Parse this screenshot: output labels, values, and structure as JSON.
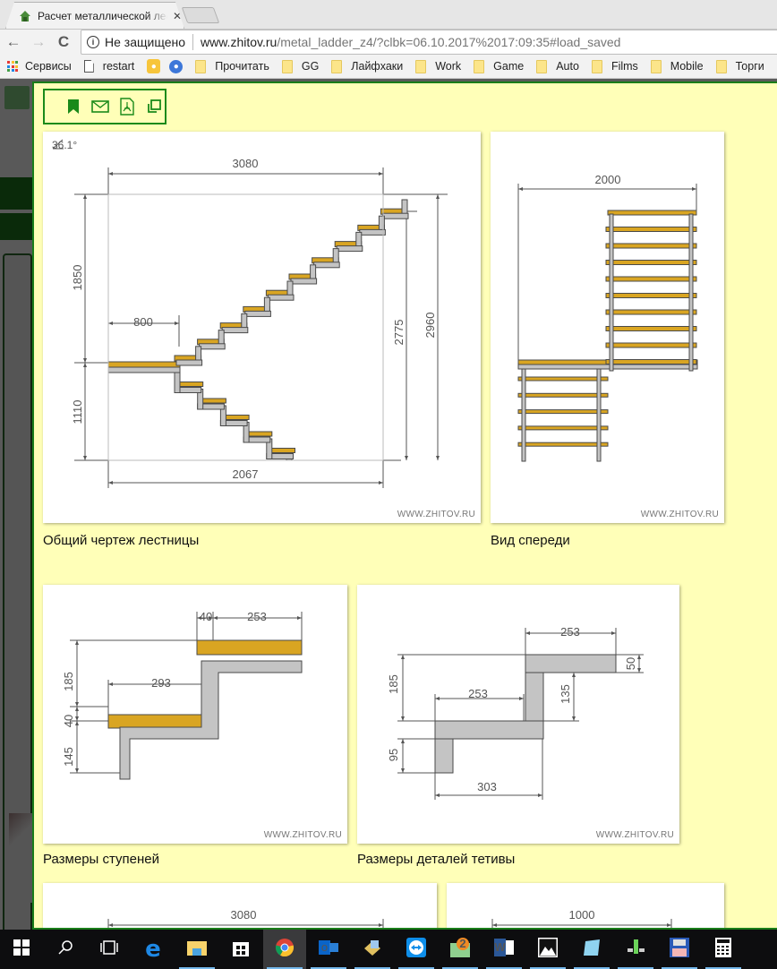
{
  "browser": {
    "tab_title": "Расчет металлической лестницы",
    "tab_close": "✕",
    "security_label": "Не защищено",
    "url_host": "www.zhitov.ru",
    "url_rest": "/metal_ladder_z4/?clbk=06.10.2017%2017:09:35#load_saved",
    "nav": {
      "back": "←",
      "forward": "→",
      "reload": "C"
    },
    "bookmarks": [
      {
        "label": "Сервисы",
        "icon": "apps-icon"
      },
      {
        "label": "restart",
        "icon": "page-icon"
      },
      {
        "label": "",
        "icon": "keep-bulb-icon"
      },
      {
        "label": "",
        "icon": "person-icon"
      },
      {
        "label": "Прочитать",
        "icon": "folder-icon"
      },
      {
        "label": "GG",
        "icon": "folder-icon"
      },
      {
        "label": "Лайфхаки",
        "icon": "folder-icon"
      },
      {
        "label": "Work",
        "icon": "folder-icon"
      },
      {
        "label": "Game",
        "icon": "folder-icon"
      },
      {
        "label": "Auto",
        "icon": "folder-icon"
      },
      {
        "label": "Films",
        "icon": "folder-icon"
      },
      {
        "label": "Mobile",
        "icon": "folder-icon"
      },
      {
        "label": "Торги",
        "icon": "folder-icon"
      }
    ]
  },
  "actions": [
    {
      "name": "bookmark-icon"
    },
    {
      "name": "email-icon"
    },
    {
      "name": "pdf-icon"
    },
    {
      "name": "copy-icon"
    }
  ],
  "drawings": {
    "general": {
      "caption": "Общий чертеж лестницы",
      "angle": "36.1°",
      "dims": {
        "top_width": "3080",
        "upper_height": "1850",
        "landing": "800",
        "lower_height": "1110",
        "bottom_width": "2067",
        "height_inner": "2775",
        "height_total": "2960"
      },
      "watermark": "WWW.ZHITOV.RU"
    },
    "front": {
      "caption": "Вид спереди",
      "dims": {
        "width": "2000"
      },
      "watermark": "WWW.ZHITOV.RU"
    },
    "steps": {
      "caption": "Размеры ступеней",
      "dims": {
        "overhang": "40",
        "tread_top": "253",
        "tread_lower": "293",
        "rise": "185",
        "thickness": "40",
        "lower": "145"
      },
      "watermark": "WWW.ZHITOV.RU"
    },
    "stringer": {
      "caption": "Размеры деталей тетивы",
      "dims": {
        "top": "253",
        "plate": "50",
        "rise": "185",
        "mid": "253",
        "riser": "135",
        "bottom": "95",
        "base": "303"
      },
      "watermark": "WWW.ZHITOV.RU"
    },
    "plan_a": {
      "dims": {
        "width": "3080"
      }
    },
    "plan_b": {
      "dims": {
        "width": "1000"
      }
    }
  },
  "taskbar": [
    {
      "name": "start-icon"
    },
    {
      "name": "search-icon"
    },
    {
      "name": "task-view-icon"
    },
    {
      "name": "edge-icon"
    },
    {
      "name": "file-explorer-icon"
    },
    {
      "name": "store-icon"
    },
    {
      "name": "chrome-icon",
      "active": true
    },
    {
      "name": "outlook-icon"
    },
    {
      "name": "installer-icon"
    },
    {
      "name": "teamviewer-icon"
    },
    {
      "name": "maps-icon"
    },
    {
      "name": "word-icon"
    },
    {
      "name": "photos-icon"
    },
    {
      "name": "notepad-icon"
    },
    {
      "name": "network-icon"
    },
    {
      "name": "save-icon"
    },
    {
      "name": "calculator-icon"
    }
  ],
  "colors": {
    "tread": "#d9a522",
    "stringer": "#c4c4c4",
    "outline": "#4a4a4a",
    "modal_bg": "#ffffb8",
    "accent_green": "#1a8a1a"
  }
}
